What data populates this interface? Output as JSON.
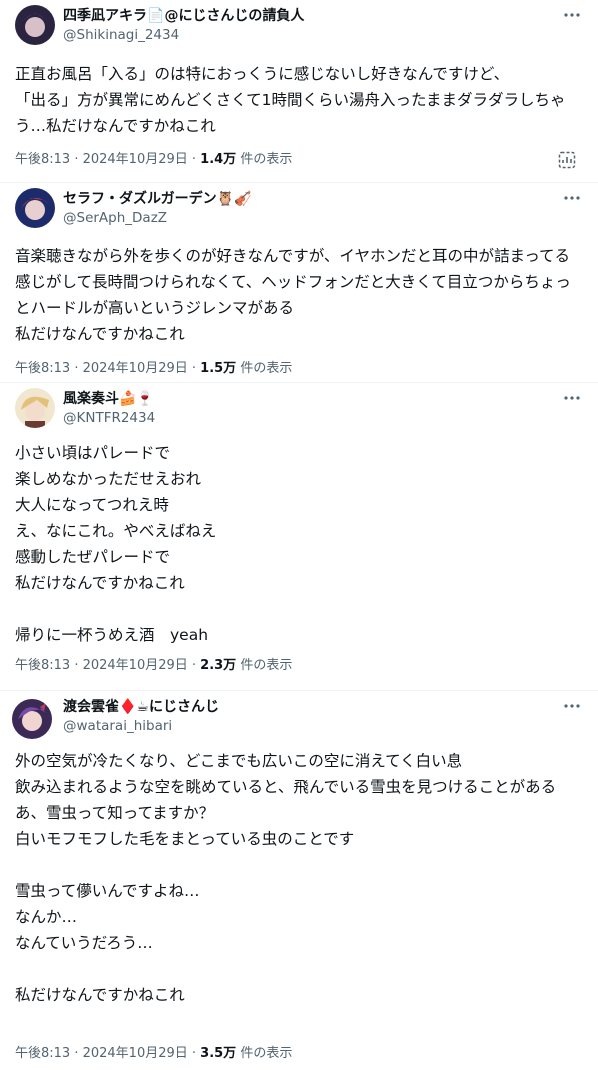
{
  "tweets": [
    {
      "name": "四季凪アキラ",
      "name_suffix": "@にじさんじの請負人",
      "name_emoji": "📄",
      "handle": "@Shikinagi_2434",
      "text": "正直お風呂「入る」のは特におっくうに感じないし好きなんですけど、\n「出る」方が異常にめんどくさくて1時間くらい湯舟入ったままダラダラしちゃう…私だけなんですかねこれ",
      "time": "午後8:13 · 2024年10月29日 · ",
      "views_count": "1.4万",
      "views_label": " 件の表示",
      "avatar_colors": [
        "#2a2440",
        "#d8c0c8"
      ]
    },
    {
      "name": "セラフ・ダズルガーデン",
      "name_suffix": "",
      "name_emoji": "🦉🎻",
      "handle": "@SerAph_DazZ",
      "text": "音楽聴きながら外を歩くのが好きなんですが、イヤホンだと耳の中が詰まってる感じがして長時間つけられなくて、ヘッドフォンだと大きくて目立つからちょっとハードルが高いというジレンマがある\n私だけなんですかねこれ",
      "time": "午後8:13 · 2024年10月29日 · ",
      "views_count": "1.5万",
      "views_label": " 件の表示",
      "avatar_colors": [
        "#1d2b6b",
        "#c23a3a"
      ]
    },
    {
      "name": "風楽奏斗",
      "name_suffix": "",
      "name_emoji": "🍰🍷",
      "handle": "@KNTFR2434",
      "text": "小さい頃はパレードで\n楽しめなかっただせえおれ\n大人になってつれえ時\nえ、なにこれ。やべえばねえ\n感動したぜパレードで\n私だけなんですかねこれ\n\n帰りに一杯うめえ酒　yeah",
      "time": "午後8:13 · 2024年10月29日 · ",
      "views_count": "2.3万",
      "views_label": " 件の表示",
      "avatar_colors": [
        "#e9d7a8",
        "#6a3a34"
      ]
    },
    {
      "name": "渡会雲雀",
      "name_suffix": "にじさんじ",
      "name_emoji": "♦️☕",
      "handle": "@watarai_hibari",
      "text": "外の空気が冷たくなり、どこまでも広いこの空に消えてく白い息\n飲み込まれるような空を眺めていると、飛んでいる雪虫を見つけることがある\nあ、雪虫って知ってますか？\n白いモフモフした毛をまとっている虫のことです\n\n雪虫って儚いんですよね…\nなんか…\nなんていうだろう…\n\n私だけなんですかねこれ",
      "time": "午後8:13 · 2024年10月29日 · ",
      "views_count": "3.5万",
      "views_label": " 件の表示",
      "avatar_colors": [
        "#3a2a55",
        "#b83a6a"
      ]
    }
  ],
  "colors": {
    "text": "#0f1419",
    "secondary": "#536471",
    "divider": "#eff3f4"
  }
}
